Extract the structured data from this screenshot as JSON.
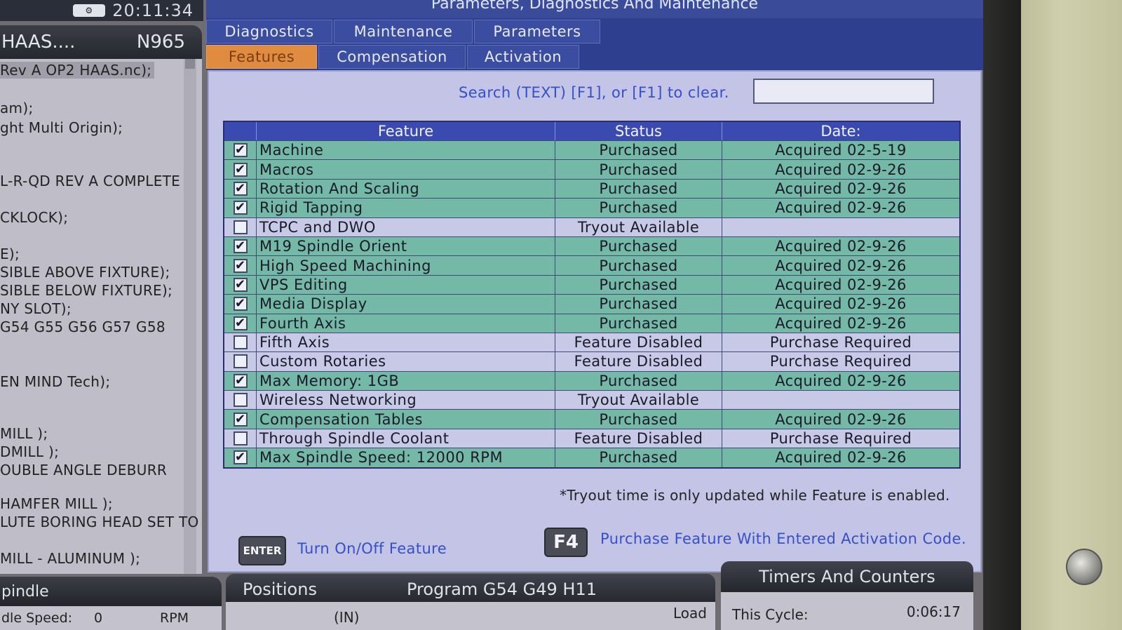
{
  "window": {
    "title": "Parameters, Diagnostics And Maintenance",
    "clock": "20:11:34"
  },
  "program_pane": {
    "header_name": "HAAS....",
    "header_line": "N965",
    "lines": [
      "Rev A OP2 HAAS.nc);",
      "",
      "am);",
      "ght Multi Origin);",
      "",
      "",
      "L-R-QD REV A COMPLETE",
      "",
      "CKLOCK);",
      "",
      "E);",
      "SIBLE ABOVE FIXTURE);",
      "SIBLE BELOW FIXTURE);",
      "NY SLOT);",
      " G54 G55 G56 G57 G58",
      "",
      "",
      "EN MIND Tech);",
      "",
      "",
      "MILL );",
      "DMILL );",
      "OUBLE ANGLE DEBURR",
      "",
      "HAMFER MILL );",
      "LUTE BORING HEAD SET TO",
      "",
      "MILL - ALUMINUM );"
    ]
  },
  "tabs_row1": [
    "Diagnostics",
    "Maintenance",
    "Parameters"
  ],
  "tabs_row2": [
    "Features",
    "Compensation",
    "Activation"
  ],
  "search": {
    "label": "Search (TEXT) [F1], or [F1] to clear.",
    "value": ""
  },
  "table": {
    "headers": [
      "Feature",
      "Status",
      "Date:"
    ],
    "rows": [
      {
        "checked": true,
        "feature": "Machine",
        "status": "Purchased",
        "date": "Acquired 02-5-19"
      },
      {
        "checked": true,
        "feature": "Macros",
        "status": "Purchased",
        "date": "Acquired 02-9-26"
      },
      {
        "checked": true,
        "feature": "Rotation And Scaling",
        "status": "Purchased",
        "date": "Acquired 02-9-26"
      },
      {
        "checked": true,
        "feature": "Rigid Tapping",
        "status": "Purchased",
        "date": "Acquired 02-9-26"
      },
      {
        "checked": false,
        "feature": "TCPC and DWO",
        "status": "Tryout Available",
        "date": ""
      },
      {
        "checked": true,
        "feature": "M19 Spindle Orient",
        "status": "Purchased",
        "date": "Acquired 02-9-26"
      },
      {
        "checked": true,
        "feature": "High Speed Machining",
        "status": "Purchased",
        "date": "Acquired 02-9-26"
      },
      {
        "checked": true,
        "feature": "VPS Editing",
        "status": "Purchased",
        "date": "Acquired 02-9-26"
      },
      {
        "checked": true,
        "feature": "Media Display",
        "status": "Purchased",
        "date": "Acquired 02-9-26"
      },
      {
        "checked": true,
        "feature": "Fourth Axis",
        "status": "Purchased",
        "date": "Acquired 02-9-26"
      },
      {
        "checked": false,
        "feature": "Fifth Axis",
        "status": "Feature Disabled",
        "date": "Purchase Required"
      },
      {
        "checked": false,
        "feature": "Custom Rotaries",
        "status": "Feature Disabled",
        "date": "Purchase Required"
      },
      {
        "checked": true,
        "feature": "Max Memory: 1GB",
        "status": "Purchased",
        "date": "Acquired 02-9-26"
      },
      {
        "checked": false,
        "feature": "Wireless Networking",
        "status": "Tryout Available",
        "date": ""
      },
      {
        "checked": true,
        "feature": "Compensation Tables",
        "status": "Purchased",
        "date": "Acquired 02-9-26"
      },
      {
        "checked": false,
        "feature": "Through Spindle Coolant",
        "status": "Feature Disabled",
        "date": "Purchase Required"
      },
      {
        "checked": true,
        "feature": "Max Spindle Speed: 12000 RPM",
        "status": "Purchased",
        "date": "Acquired 02-9-26"
      }
    ]
  },
  "note": "*Tryout time is only updated while Feature is enabled.",
  "actions": {
    "enter_key": "ENTER",
    "enter_hint": "Turn On/Off Feature",
    "f4_key": "F4",
    "f4_hint": "Purchase Feature With Entered Activation Code."
  },
  "bottom": {
    "spindle_title": "pindle",
    "spindle_label": "dle Speed:",
    "spindle_value": "0",
    "spindle_unit": "RPM",
    "positions_title": "Positions",
    "program_title": "Program G54 G49 H11",
    "positions_unit": "(IN)",
    "load_label": "Load",
    "timers_title": "Timers And Counters",
    "cycle_label": "This Cycle:",
    "cycle_value": "0:06:17"
  },
  "colors": {
    "purchased_row": "#74b9a6",
    "unpurchased_row": "#c8c9e6",
    "active_tab": "#e08c40",
    "accent_blue": "#3550c8"
  }
}
